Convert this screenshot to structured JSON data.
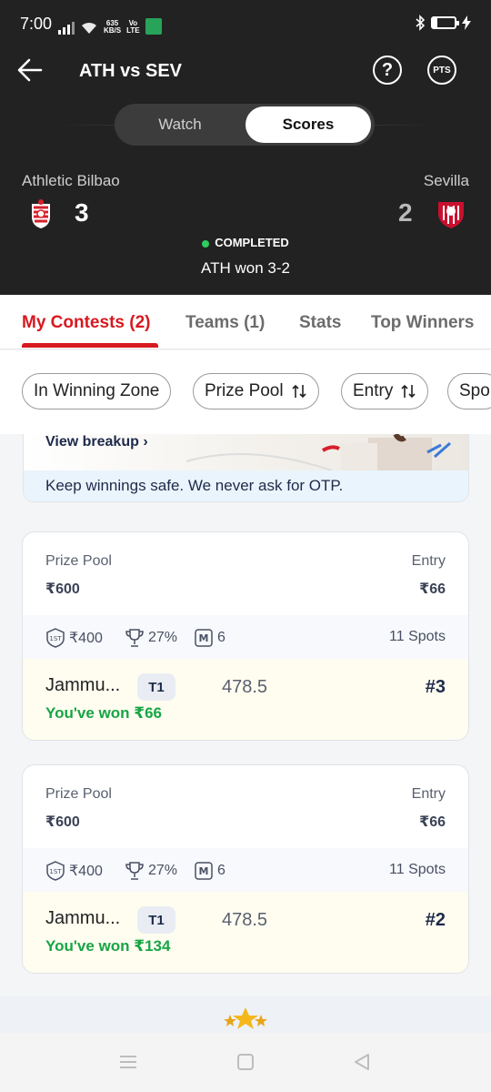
{
  "status_bar": {
    "time": "7:00",
    "speed_value": "635",
    "speed_unit": "KB/S",
    "network_top": "Vo",
    "network_bottom": "LTE",
    "battery_level": 0.2
  },
  "header": {
    "title": "ATH vs SEV",
    "help_icon": "?",
    "points_badge": "PTS",
    "toggle": {
      "watch": "Watch",
      "scores": "Scores",
      "selected": "Scores"
    }
  },
  "match": {
    "home": {
      "name": "Athletic Bilbao",
      "score": "3",
      "crest_color": "#d6202a"
    },
    "away": {
      "name": "Sevilla",
      "score": "2",
      "crest_color": "#c8102e"
    },
    "status": "COMPLETED",
    "result": "ATH won 3-2"
  },
  "tabs": [
    {
      "label": "My Contests (2)",
      "active": true
    },
    {
      "label": "Teams (1)",
      "active": false
    },
    {
      "label": "Stats",
      "active": false
    },
    {
      "label": "Top Winners",
      "active": false
    }
  ],
  "filters": [
    "In Winning Zone",
    "Prize Pool",
    "Entry",
    "Spo"
  ],
  "banner": {
    "view_breakup": "View breakup",
    "note": "Keep winnings safe. We never ask for OTP."
  },
  "contests": [
    {
      "prize_label": "Prize Pool",
      "prize_value": "₹600",
      "entry_label": "Entry",
      "entry_value": "₹66",
      "first_prize": "₹400",
      "win_percent": "27%",
      "multi_entry": "6",
      "spots": "11 Spots",
      "team_name": "Jammu...",
      "team_badge": "T1",
      "points": "478.5",
      "rank": "#3",
      "won": "You've won ₹66"
    },
    {
      "prize_label": "Prize Pool",
      "prize_value": "₹600",
      "entry_label": "Entry",
      "entry_value": "₹66",
      "first_prize": "₹400",
      "win_percent": "27%",
      "multi_entry": "6",
      "spots": "11 Spots",
      "team_name": "Jammu...",
      "team_badge": "T1",
      "points": "478.5",
      "rank": "#2",
      "won": "You've won ₹134"
    }
  ],
  "meta_icons": {
    "first": "1ST",
    "multi": "M"
  },
  "colors": {
    "accent": "#d71920",
    "header_bg": "#222222",
    "won_green": "#17a545",
    "completed_dot": "#2ecc5e"
  },
  "icons": [
    "back-arrow-icon",
    "help-icon",
    "points-icon",
    "first-prize-icon",
    "trophy-icon",
    "multi-entry-icon",
    "sort-icon",
    "chevron-right-icon"
  ]
}
